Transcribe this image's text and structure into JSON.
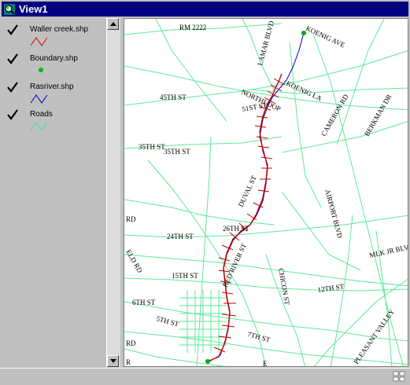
{
  "window": {
    "title": "View1",
    "icon": "magnifier-map-icon"
  },
  "legend": {
    "layers": [
      {
        "name": "Waller creek.shp",
        "checked": true,
        "symbol": "line",
        "color": "#e00000"
      },
      {
        "name": "Boundary.shp",
        "checked": true,
        "symbol": "point",
        "color": "#00c000"
      },
      {
        "name": "Rasriver.shp",
        "checked": true,
        "symbol": "line",
        "color": "#0000c0"
      },
      {
        "name": "Roads",
        "checked": true,
        "symbol": "line",
        "color": "#40e0a0"
      }
    ]
  },
  "map": {
    "road_color": "#5ee89a",
    "creek_color": "#c00000",
    "river_color": "#0000c0",
    "boundary_color": "#00b000",
    "labels": {
      "rm2222": "RM 2222",
      "lamar": "LAMAR BLVD",
      "koenig_ave": "KOENIG AVE",
      "koenig_la": "KOENIG LA",
      "northloop": "NORTHLOOP",
      "st51": "51ST ST",
      "st45": "45TH ST",
      "cameron": "CAMERON RD",
      "berkman": "BERKMAN DR",
      "st35": "35TH ST",
      "st35b": "35TH ST",
      "duval": "DUVAL ST",
      "airport": "AIRPORT BLVD",
      "rd_left": "RD",
      "st26": "26TH ST",
      "st24": "24TH ST",
      "red_river": "RED RIVER ST",
      "mlk": "MLK JR BLV",
      "rd_left2": "ELD RD",
      "st15": "15TH ST",
      "chicon": "CHICON ST",
      "st12": "12TH ST",
      "st6": "6TH ST",
      "st5": "5TH ST",
      "st7": "7TH ST",
      "pleasant": "PLEASANT VALLEY",
      "rd_left3": "RD",
      "r_left": "R",
      "e": "E"
    }
  }
}
